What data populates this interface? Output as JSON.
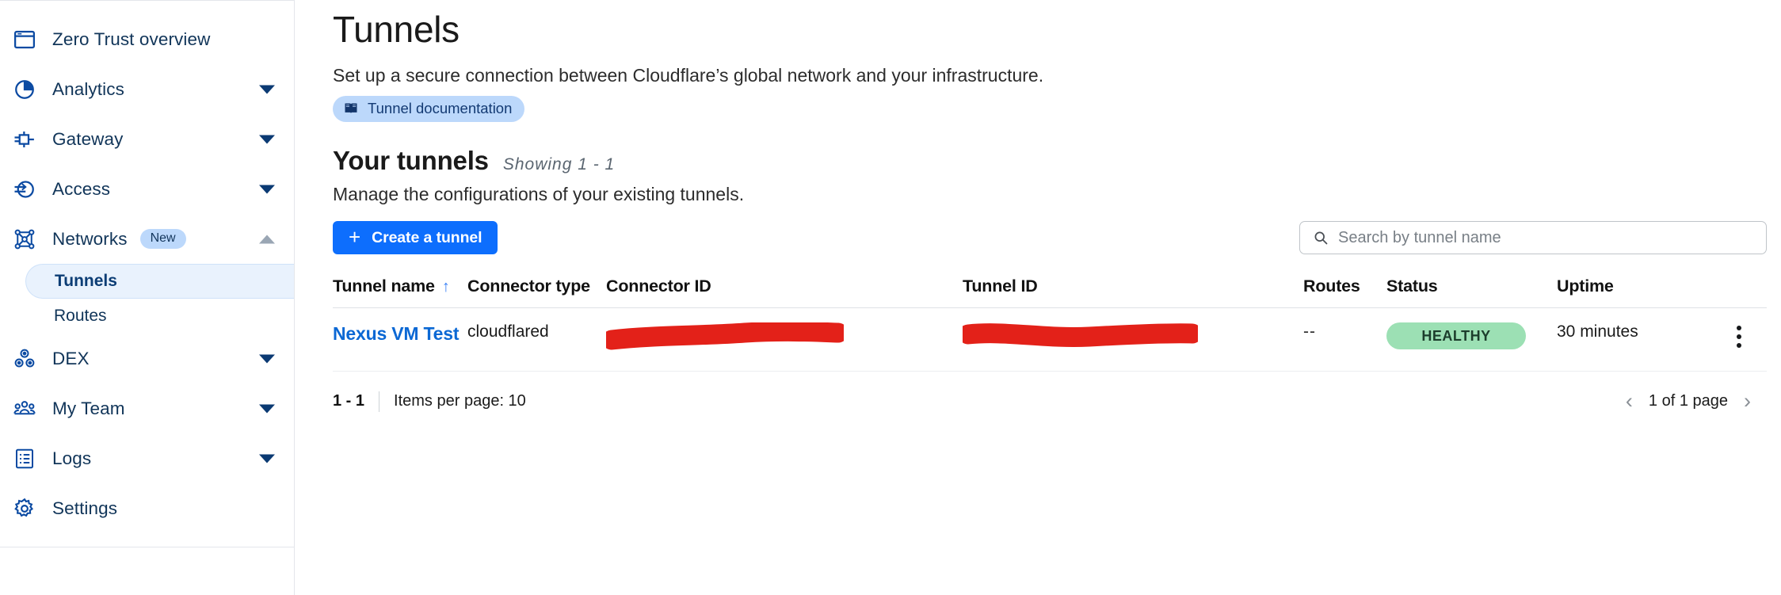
{
  "sidebar": {
    "items": [
      {
        "label": "Zero Trust overview",
        "icon": "window-icon",
        "expandable": false,
        "expanded": false
      },
      {
        "label": "Analytics",
        "icon": "pie-chart-icon",
        "expandable": true,
        "expanded": false
      },
      {
        "label": "Gateway",
        "icon": "gateway-icon",
        "expandable": true,
        "expanded": false
      },
      {
        "label": "Access",
        "icon": "access-icon",
        "expandable": true,
        "expanded": false
      },
      {
        "label": "Networks",
        "icon": "network-icon",
        "expandable": true,
        "expanded": true,
        "badge": "New"
      },
      {
        "label": "DEX",
        "icon": "dex-icon",
        "expandable": true,
        "expanded": false
      },
      {
        "label": "My Team",
        "icon": "team-icon",
        "expandable": true,
        "expanded": false
      },
      {
        "label": "Logs",
        "icon": "logs-icon",
        "expandable": true,
        "expanded": false
      },
      {
        "label": "Settings",
        "icon": "gear-icon",
        "expandable": false,
        "expanded": false
      }
    ],
    "networks_children": [
      {
        "label": "Tunnels",
        "active": true
      },
      {
        "label": "Routes",
        "active": false
      }
    ]
  },
  "header": {
    "title": "Tunnels",
    "subtitle": "Set up a secure connection between Cloudflare’s global network and your infrastructure.",
    "doc_link": "Tunnel documentation",
    "doc_icon": "book-icon"
  },
  "section": {
    "title": "Your tunnels",
    "showing": "Showing 1 - 1",
    "description": "Manage the configurations of your existing tunnels."
  },
  "toolbar": {
    "create_label": "Create a tunnel",
    "create_icon": "plus-icon",
    "search_placeholder": "Search by tunnel name",
    "search_value": "",
    "search_icon": "search-icon"
  },
  "table": {
    "columns": [
      {
        "label": "Tunnel name",
        "sorted": "asc",
        "sort_icon": "arrow-up-icon"
      },
      {
        "label": "Connector type"
      },
      {
        "label": "Connector ID"
      },
      {
        "label": "Tunnel ID"
      },
      {
        "label": "Routes"
      },
      {
        "label": "Status"
      },
      {
        "label": "Uptime"
      }
    ],
    "rows": [
      {
        "tunnel_name": "Nexus VM Test",
        "connector_type": "cloudflared",
        "connector_id": "",
        "connector_id_redacted": true,
        "tunnel_id": "",
        "tunnel_id_redacted": true,
        "routes": "--",
        "status": "HEALTHY",
        "uptime": "30 minutes",
        "menu_icon": "kebab-menu-icon"
      }
    ]
  },
  "footer": {
    "range": "1 - 1",
    "items_per_page": "Items per page: 10",
    "page_label": "1 of 1 page",
    "prev_icon": "chevron-left-icon",
    "next_icon": "chevron-right-icon"
  },
  "colors": {
    "accent_blue": "#0d6efd",
    "link_blue": "#0b68d4",
    "nav_text": "#113559",
    "pill_bg": "#bcd8fb",
    "active_item_bg": "#e9f2fd",
    "healthy_bg": "#9ce0b4",
    "redaction_red": "#e32119"
  }
}
